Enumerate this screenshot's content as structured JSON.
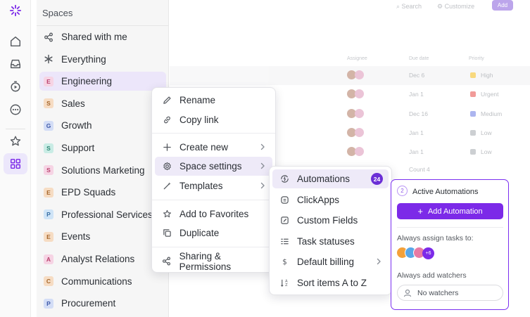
{
  "sidebar": {
    "header": "Spaces",
    "items": [
      {
        "label": "Shared with me",
        "icon": "share-icon"
      },
      {
        "label": "Everything",
        "icon": "asterisk-icon"
      },
      {
        "label": "Engineering",
        "letter": "E",
        "color": "#f6d4e4",
        "text_color": "#b9426e",
        "selected": true
      },
      {
        "label": "Sales",
        "letter": "S",
        "color": "#f6dcc3",
        "text_color": "#a4652a"
      },
      {
        "label": "Growth",
        "letter": "G",
        "color": "#d3ddf6",
        "text_color": "#3e59a8"
      },
      {
        "label": "Support",
        "letter": "S",
        "color": "#c9ece5",
        "text_color": "#2e8574"
      },
      {
        "label": "Solutions Marketing",
        "letter": "S",
        "color": "#f6d4e4",
        "text_color": "#b9426e"
      },
      {
        "label": "EPD Squads",
        "letter": "E",
        "color": "#f6dcc3",
        "text_color": "#a4652a"
      },
      {
        "label": "Professional Services",
        "letter": "P",
        "color": "#cfe4f7",
        "text_color": "#3a6fa4"
      },
      {
        "label": "Events",
        "letter": "E",
        "color": "#f6dcc3",
        "text_color": "#a4652a"
      },
      {
        "label": "Analyst Relations",
        "letter": "A",
        "color": "#f6d4e4",
        "text_color": "#b9426e"
      },
      {
        "label": "Communications",
        "letter": "C",
        "color": "#f6dcc3",
        "text_color": "#a4652a"
      },
      {
        "label": "Procurement",
        "letter": "P",
        "color": "#d3ddf6",
        "text_color": "#3e59a8"
      }
    ]
  },
  "rail": {
    "icons": [
      "home-icon",
      "inbox-icon",
      "timer-icon",
      "more-icon",
      "star-icon",
      "spaces-grid-icon"
    ]
  },
  "background": {
    "top_actions": [
      "Search",
      "Customize",
      "Add"
    ],
    "columns": [
      "Assignee",
      "Due date",
      "Priority"
    ],
    "rows": [
      {
        "due": "Dec 6",
        "priority": "High",
        "flag": "#f2b400"
      },
      {
        "due": "Jan 1",
        "priority": "Urgent",
        "flag": "#e53935"
      },
      {
        "due": "Dec 16",
        "priority": "Medium",
        "flag": "#5b6ee0"
      },
      {
        "due": "Jan 1",
        "priority": "Low",
        "flag": "#9aa0a6"
      },
      {
        "due": "Jan 1",
        "priority": "Low",
        "flag": "#9aa0a6"
      }
    ],
    "count_label": "Count 4"
  },
  "context_menu": {
    "items": [
      {
        "label": "Rename",
        "icon": "pencil-icon"
      },
      {
        "label": "Copy link",
        "icon": "link-icon"
      },
      {
        "label": "Create new",
        "icon": "plus-icon",
        "submenu": true
      },
      {
        "label": "Space settings",
        "icon": "gear-icon",
        "submenu": true,
        "highlighted": true
      },
      {
        "label": "Templates",
        "icon": "magic-wand-icon",
        "submenu": true
      },
      {
        "label": "Add to Favorites",
        "icon": "star-icon"
      },
      {
        "label": "Duplicate",
        "icon": "copy-icon"
      },
      {
        "label": "Sharing & Permissions",
        "icon": "share-icon"
      }
    ]
  },
  "settings_menu": {
    "items": [
      {
        "label": "Automations",
        "icon": "automation-icon",
        "badge": "24",
        "highlighted": true
      },
      {
        "label": "ClickApps",
        "icon": "clickapps-icon"
      },
      {
        "label": "Custom Fields",
        "icon": "edit-field-icon"
      },
      {
        "label": "Task statuses",
        "icon": "status-list-icon"
      },
      {
        "label": "Default billing",
        "icon": "dollar-icon",
        "submenu": true
      },
      {
        "label": "Sort items A to Z",
        "icon": "sort-az-icon"
      }
    ]
  },
  "automation_panel": {
    "step": "2",
    "title": "Active Automations",
    "add_button": "Add Automation",
    "assign_label": "Always assign tasks to:",
    "assignee_colors": [
      "#f4a13a",
      "#5aa7e8",
      "#e87aa4"
    ],
    "more_assignees": "+6",
    "watchers_label": "Always add watchers",
    "watchers_value": "No watchers",
    "accent": "#7c2ae8"
  }
}
